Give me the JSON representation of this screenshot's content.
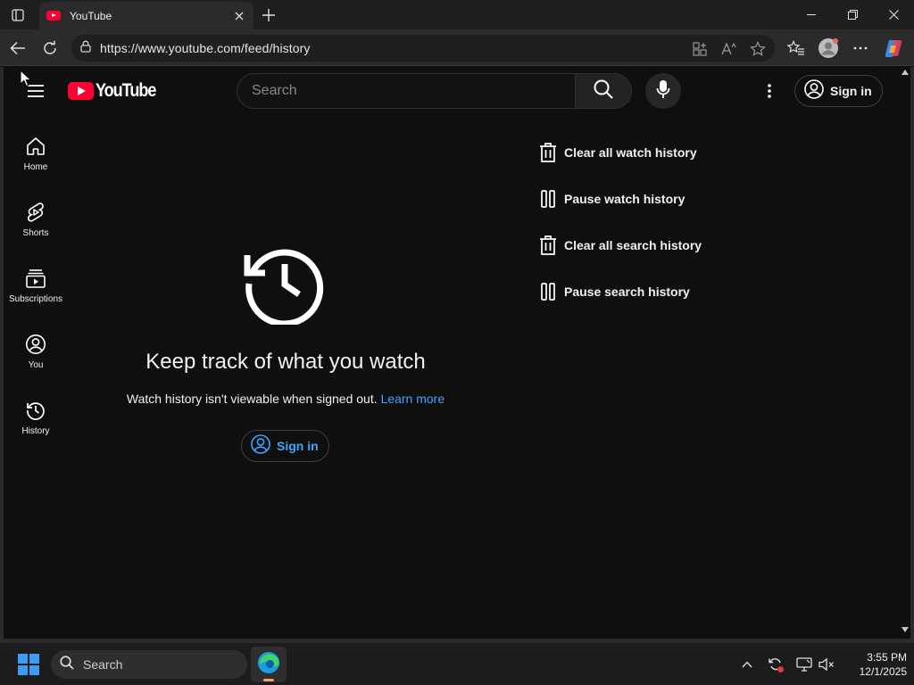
{
  "browser": {
    "tab_title": "YouTube",
    "url": "https://www.youtube.com/feed/history"
  },
  "youtube": {
    "logo_text": "YouTube",
    "search_placeholder": "Search",
    "signin_label": "Sign in",
    "nav": [
      {
        "label": "Home",
        "icon": "home-icon"
      },
      {
        "label": "Shorts",
        "icon": "shorts-icon"
      },
      {
        "label": "Subscriptions",
        "icon": "subscriptions-icon"
      },
      {
        "label": "You",
        "icon": "you-icon"
      },
      {
        "label": "History",
        "icon": "history-icon"
      }
    ],
    "main": {
      "title": "Keep track of what you watch",
      "subtitle": "Watch history isn't viewable when signed out.",
      "learn_more": "Learn more",
      "signin_label": "Sign in"
    },
    "actions": [
      {
        "label": "Clear all watch history",
        "icon": "trash-icon"
      },
      {
        "label": "Pause watch history",
        "icon": "pause-icon"
      },
      {
        "label": "Clear all search history",
        "icon": "trash-icon"
      },
      {
        "label": "Pause search history",
        "icon": "pause-icon"
      }
    ]
  },
  "taskbar": {
    "search_label": "Search",
    "time": "3:55 PM",
    "date": "12/1/2025"
  },
  "colors": {
    "accent_blue": "#3ea6ff",
    "youtube_red": "#ff0033",
    "background": "#0f0f0f"
  }
}
